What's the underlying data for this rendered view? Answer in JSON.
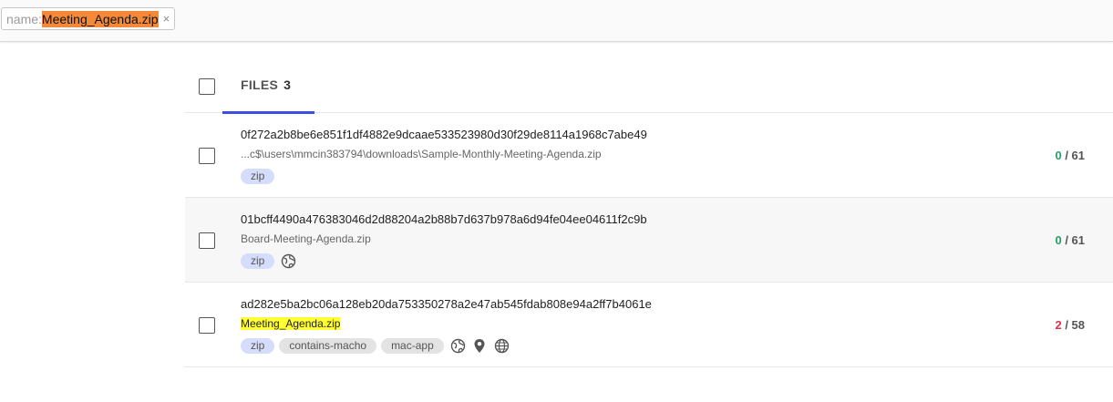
{
  "search": {
    "key": "name:",
    "value": "Meeting_Agenda.zip",
    "close": "×"
  },
  "tabs": {
    "files_label": "FILES",
    "files_count": "3"
  },
  "rows": [
    {
      "hash": "0f272a2b8be6e851f1df4882e9dcaae533523980d30f29de8114a1968c7abe49",
      "name": "...c$\\users\\mmcin383794\\downloads\\Sample-Monthly-Meeting-Agenda.zip",
      "tags": [
        "zip"
      ],
      "detections": "0",
      "total": "/ 61"
    },
    {
      "hash": "01bcff4490a476383046d2d88204a2b88b7d637b978a6d94fe04ee04611f2c9b",
      "name": "Board-Meeting-Agenda.zip",
      "tags": [
        "zip"
      ],
      "icons": [
        "network-globe-icon"
      ],
      "detections": "0",
      "total": "/ 61"
    },
    {
      "hash": "ad282e5ba2bc06a128eb20da753350278a2e47ab545fdab808e94a2ff7b4061e",
      "name": "Meeting_Agenda.zip",
      "tags": [
        "zip",
        "contains-macho",
        "mac-app"
      ],
      "icons": [
        "network-globe-icon",
        "location-pin-icon",
        "web-globe-icon"
      ],
      "detections": "2",
      "total": "/ 58"
    }
  ],
  "colors": {
    "accent": "#3d4de0",
    "clean": "#21a06a",
    "malicious": "#e0314b",
    "search_highlight": "#f4893a",
    "name_highlight": "#ffff33"
  }
}
